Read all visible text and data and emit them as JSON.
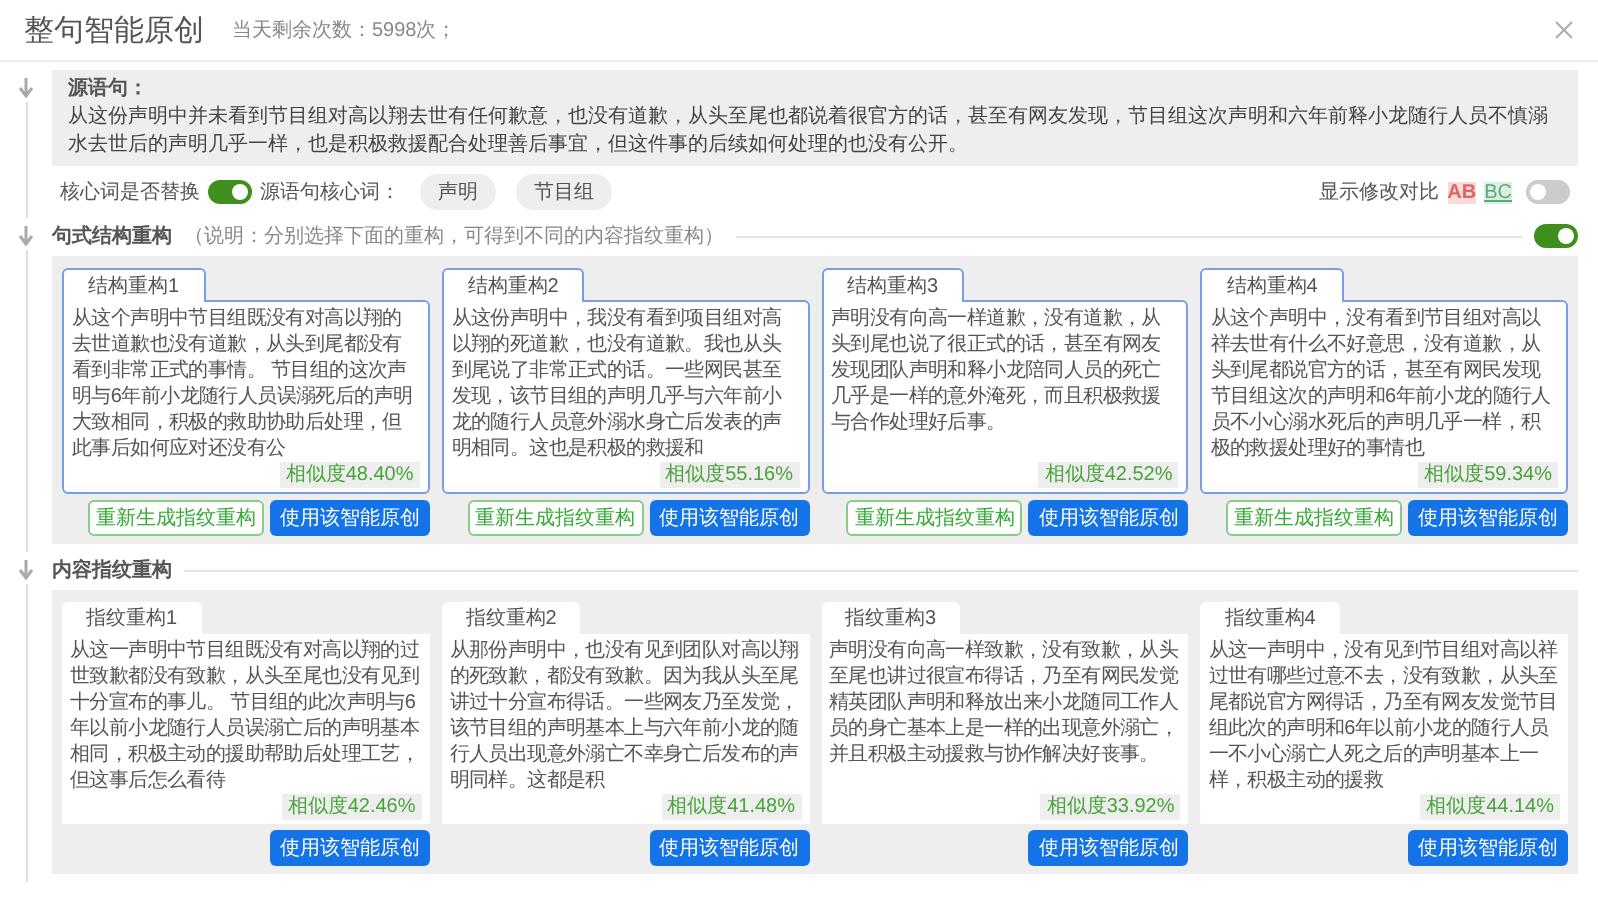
{
  "dialog": {
    "title": "整句智能原创",
    "remaining": "当天剩余次数：5998次；"
  },
  "source": {
    "label": "源语句：",
    "text": "从这份声明中并未看到节目组对高以翔去世有任何歉意，也没有道歉，从头至尾也都说着很官方的话，甚至有网友发现，节目组这次声明和六年前释小龙随行人员不慎溺水去世后的声明几乎一样，也是积极救援配合处理善后事宜，但这件事的后续如何处理的也没有公开。"
  },
  "core": {
    "replace_label": "核心词是否替换",
    "replace_on": true,
    "keywords_label": "源语句核心词：",
    "keywords": [
      "声明",
      "节目组"
    ],
    "diff_label": "显示修改对比",
    "diff_removed": "AB",
    "diff_added": "BC",
    "diff_on": false
  },
  "sections": [
    {
      "kind": "structure",
      "title": "句式结构重构",
      "note": "（说明：分别选择下面的重构，可得到不同的内容指纹重构）",
      "toggle_on": true,
      "cards": [
        {
          "tab": "结构重构1",
          "text": "从这个声明中节目组既没有对高以翔的去世道歉也没有道歉，从头到尾都没有看到非常正式的事情。 节目组的这次声明与6年前小龙随行人员误溺死后的声明大致相同，积极的救助协助后处理，但此事后如何应对还没有公",
          "similarity": "相似度48.40%",
          "regen": "重新生成指纹重构",
          "use": "使用该智能原创"
        },
        {
          "tab": "结构重构2",
          "text": "从这份声明中，我没有看到项目组对高以翔的死道歉，也没有道歉。我也从头到尾说了非常正式的话。一些网民甚至发现，该节目组的声明几乎与六年前小龙的随行人员意外溺水身亡后发表的声明相同。这也是积极的救援和",
          "similarity": "相似度55.16%",
          "regen": "重新生成指纹重构",
          "use": "使用该智能原创"
        },
        {
          "tab": "结构重构3",
          "text": "声明没有向高一样道歉，没有道歉，从头到尾也说了很正式的话，甚至有网友发现团队声明和释小龙陪同人员的死亡几乎是一样的意外淹死，而且积极救援与合作处理好后事。",
          "similarity": "相似度42.52%",
          "regen": "重新生成指纹重构",
          "use": "使用该智能原创"
        },
        {
          "tab": "结构重构4",
          "text": "从这个声明中，没有看到节目组对高以祥去世有什么不好意思，没有道歉，从头到尾都说官方的话，甚至有网民发现节目组这次的声明和6年前小龙的随行人员不小心溺水死后的声明几乎一样，积极的救援处理好的事情也",
          "similarity": "相似度59.34%",
          "regen": "重新生成指纹重构",
          "use": "使用该智能原创"
        }
      ]
    },
    {
      "kind": "content",
      "title": "内容指纹重构",
      "cards": [
        {
          "tab": "指纹重构1",
          "text": "从这一声明中节目组既没有对高以翔的过世致歉都没有致歉，从头至尾也没有见到十分宣布的事儿。 节目组的此次声明与6年以前小龙随行人员误溺亡后的声明基本相同，积极主动的援助帮助后处理工艺，但这事后怎么看待",
          "similarity": "相似度42.46%",
          "use": "使用该智能原创"
        },
        {
          "tab": "指纹重构2",
          "text": "从那份声明中，也没有见到团队对高以翔的死致歉，都没有致歉。因为我从头至尾讲过十分宣布得话。一些网友乃至发觉，该节目组的声明基本上与六年前小龙的随行人员出现意外溺亡不幸身亡后发布的声明同样。这都是积",
          "similarity": "相似度41.48%",
          "use": "使用该智能原创"
        },
        {
          "tab": "指纹重构3",
          "text": "声明没有向高一样致歉，没有致歉，从头至尾也讲过很宣布得话，乃至有网民发觉精英团队声明和释放出来小龙随同工作人员的身亡基本上是一样的出现意外溺亡，并且积极主动援救与协作解决好丧事。",
          "similarity": "相似度33.92%",
          "use": "使用该智能原创"
        },
        {
          "tab": "指纹重构4",
          "text": "从这一声明中，没有见到节目组对高以祥过世有哪些过意不去，没有致歉，从头至尾都说官方网得话，乃至有网友发觉节目组此次的声明和6年以前小龙的随行人员一不小心溺亡人死之后的声明基本上一样，积极主动的援救",
          "similarity": "相似度44.14%",
          "use": "使用该智能原创"
        }
      ]
    }
  ]
}
